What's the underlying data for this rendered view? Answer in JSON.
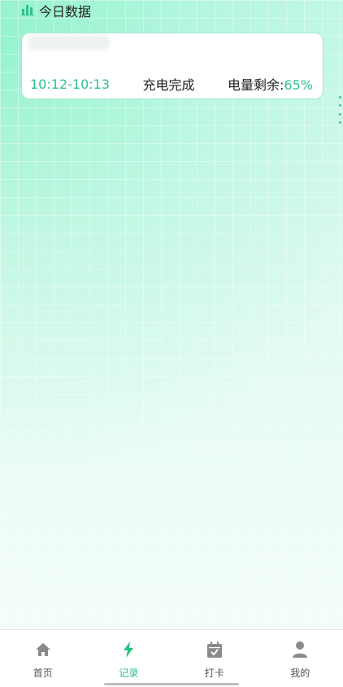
{
  "header": {
    "title": "今日数据",
    "icon": "bar-chart-icon",
    "accent": "#2fc28b"
  },
  "record": {
    "time_range": "10:12-10:13",
    "status": "充电完成",
    "battery_label": "电量剩余:",
    "battery_percent": "65%"
  },
  "tabbar": {
    "active_color": "#24c27d",
    "inactive_color": "#8a8a8a",
    "tabs": [
      {
        "label": "首页",
        "icon": "home-icon"
      },
      {
        "label": "记录",
        "icon": "lightning-icon"
      },
      {
        "label": "打卡",
        "icon": "calendar-check-icon"
      },
      {
        "label": "我的",
        "icon": "user-icon"
      }
    ]
  }
}
